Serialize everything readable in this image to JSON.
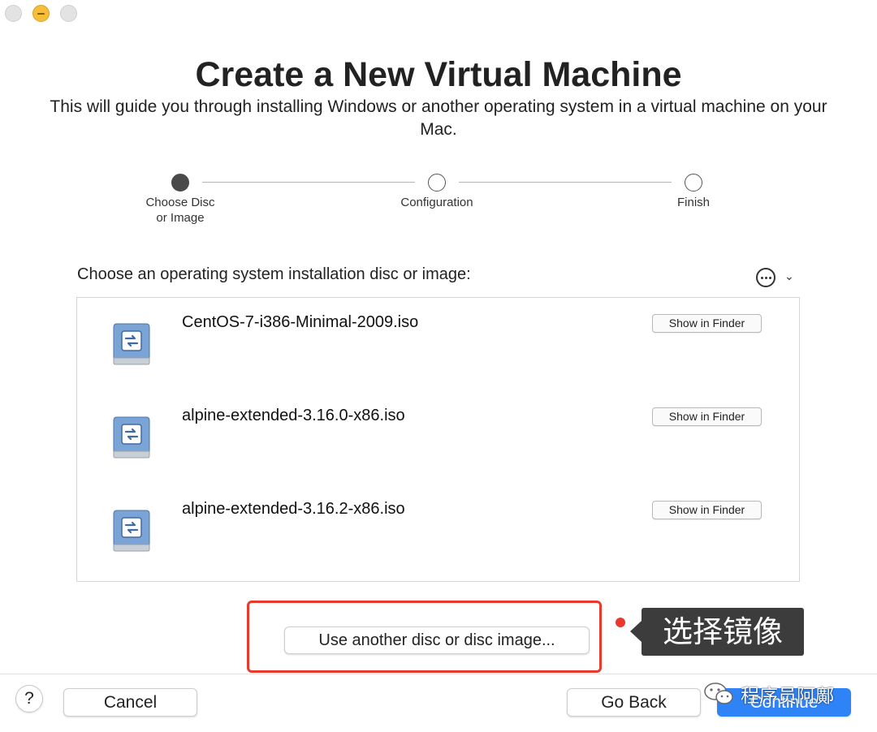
{
  "window": {
    "title": "Create a New Virtual Machine",
    "subtitle": "This will guide you through installing Windows or another operating system in a virtual machine on your Mac."
  },
  "steps": [
    {
      "label": "Choose Disc\nor Image",
      "state": "active"
    },
    {
      "label": "Configuration",
      "state": "pending"
    },
    {
      "label": "Finish",
      "state": "pending"
    }
  ],
  "chooser": {
    "label": "Choose an operating system installation disc or image:",
    "more_icon": "ellipsis-circle-icon",
    "dropdown_icon": "chevron-down-icon",
    "items": [
      {
        "name": "CentOS-7-i386-Minimal-2009.iso",
        "button": "Show in Finder",
        "icon": "disc-image-icon"
      },
      {
        "name": "alpine-extended-3.16.0-x86.iso",
        "button": "Show in Finder",
        "icon": "disc-image-icon"
      },
      {
        "name": "alpine-extended-3.16.2-x86.iso",
        "button": "Show in Finder",
        "icon": "disc-image-icon"
      }
    ]
  },
  "other_disc_button": "Use another disc or disc image...",
  "annotation": {
    "text": "选择镜像",
    "color": "#e8392c"
  },
  "footer": {
    "help": "?",
    "cancel": "Cancel",
    "go_back": "Go Back",
    "continue": "Continue",
    "accent": "#2e83f6"
  },
  "watermark": {
    "text": "程序员阿鄺",
    "icon": "wechat-icon"
  }
}
